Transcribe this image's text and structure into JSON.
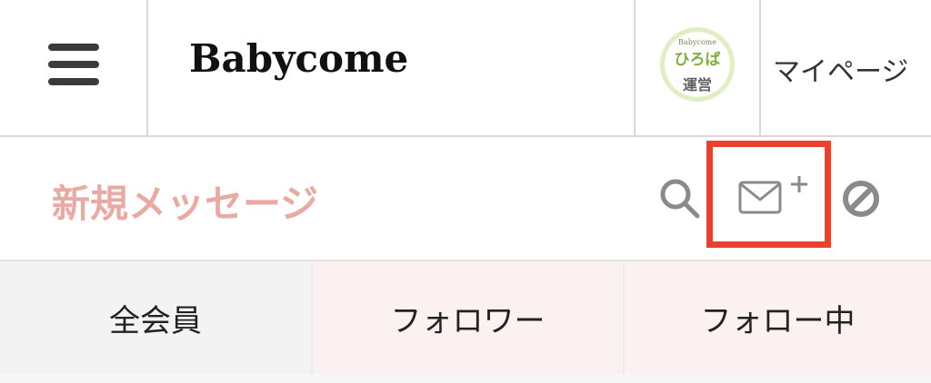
{
  "header": {
    "brand": "Babycome",
    "avatar": {
      "top_text": "Babycome",
      "middle_text": "ひろば",
      "bottom_text": "運営"
    },
    "mypage_label": "マイページ",
    "icons": {
      "menu": "hamburger-menu-icon"
    }
  },
  "message_bar": {
    "title": "新規メッセージ",
    "icons": [
      "search-icon",
      "new-message-icon",
      "block-icon"
    ],
    "highlight_color": "#e8422e"
  },
  "tabs": [
    {
      "label": "全会員"
    },
    {
      "label": "フォロワー"
    },
    {
      "label": "フォロー中"
    }
  ],
  "colors": {
    "title": "#e8aaa3",
    "tab_active_bg": "#f3f3f3",
    "tab_inactive_bg": "#fbf1f0",
    "icon_gray": "#8a8a8a"
  }
}
